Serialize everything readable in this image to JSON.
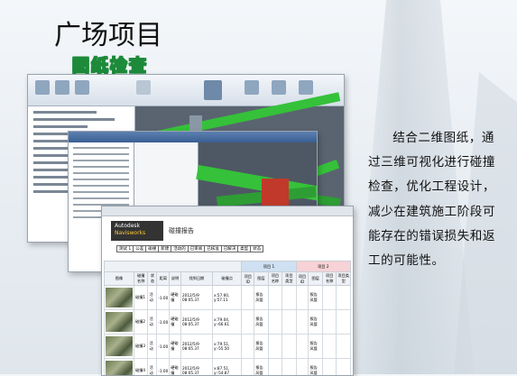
{
  "slide": {
    "title": "广场项目",
    "subtitle": "图纸检查",
    "description": "结合二维图纸，通过三维可视化进行碰撞检查，优化工程设计，减少在建筑施工阶段可能存在的错误损失和返工的可能性。"
  },
  "report": {
    "logo_line1": "Autodesk",
    "logo_line2": "Navisworks",
    "heading": "碰撞报告",
    "summary_cells": [
      "测试 1",
      "公差",
      "碰撞",
      "新建",
      "活动的",
      "已审阅",
      "已核准",
      "已解决",
      "类型",
      "状态"
    ],
    "columns": [
      "图像",
      "碰撞名称",
      "状态",
      "距离",
      "说明",
      "找到日期",
      "碰撞点",
      "项目 ID",
      "图层",
      "项目名称",
      "项目类型",
      "项目 ID",
      "图层",
      "项目名称",
      "项目类型"
    ],
    "group_headers": [
      "项目 1",
      "项目 2"
    ],
    "rows": [
      {
        "name": "碰撞1",
        "status": "活动",
        "distance": "-1.00",
        "desc": "硬碰撞",
        "date": "2012/5/9 08:05.37",
        "point": "x:57.60, y:57.11",
        "layer": "报告风管"
      },
      {
        "name": "碰撞2",
        "status": "活动",
        "distance": "-1.00",
        "desc": "硬碰撞",
        "date": "2012/5/9 08:05.37",
        "point": "x:79.04, y:-66.61",
        "layer": "报告风管"
      },
      {
        "name": "碰撞3",
        "status": "活动",
        "distance": "-1.00",
        "desc": "硬碰撞",
        "date": "2012/5/9 08:05.37",
        "point": "x:79.51, y:-55.50",
        "layer": "报告风管"
      },
      {
        "name": "碰撞4",
        "status": "活动",
        "distance": "-1.00",
        "desc": "硬碰撞",
        "date": "2012/5/9 08:05.37",
        "point": "x:87.51, y:-54.87",
        "layer": "报告风管"
      }
    ]
  },
  "colors": {
    "accent_green": "#1d8a3a",
    "beam_green": "#35c13a",
    "beam_red": "#c0392b"
  }
}
